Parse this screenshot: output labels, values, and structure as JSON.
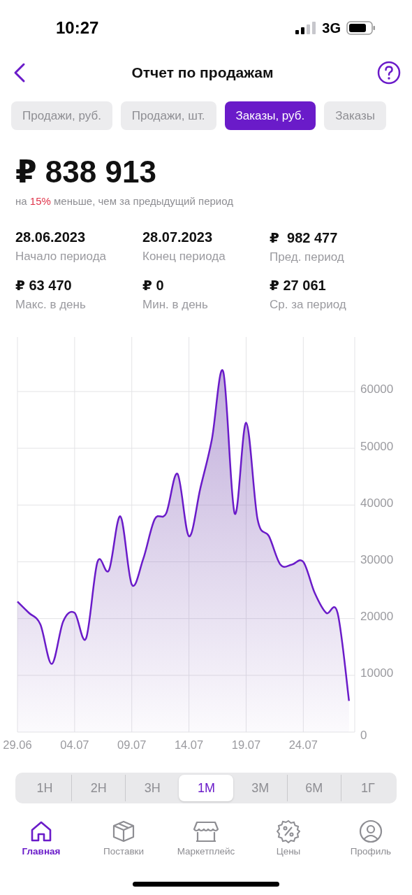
{
  "status_bar": {
    "time": "10:27",
    "network": "3G"
  },
  "header": {
    "title": "Отчет по продажам"
  },
  "tabs": [
    {
      "label": "Продажи, руб.",
      "selected": false
    },
    {
      "label": "Продажи, шт.",
      "selected": false
    },
    {
      "label": "Заказы, руб.",
      "selected": true
    },
    {
      "label": "Заказы",
      "selected": false
    }
  ],
  "total": {
    "amount": "₽ 838 913",
    "comparison": {
      "before": "на",
      "highlight": "15%",
      "after": "меньше, чем за предыдущий период"
    }
  },
  "stats": [
    {
      "value": "28.06.2023",
      "label": "Начало периода"
    },
    {
      "value": "28.07.2023",
      "label": "Конец периода"
    },
    {
      "value": "₽  982 477",
      "label": "Пред. период"
    },
    {
      "value": "₽ 63 470",
      "label": "Макс. в день"
    },
    {
      "value": "₽ 0",
      "label": "Мин. в день"
    },
    {
      "value": "₽ 27 061",
      "label": "Ср. за период"
    }
  ],
  "chart": {
    "chart_data": {
      "type": "area",
      "grid": true,
      "categories": [
        "29.06",
        null,
        null,
        null,
        null,
        "04.07",
        null,
        null,
        null,
        null,
        "09.07",
        null,
        null,
        null,
        null,
        "14.07",
        null,
        null,
        null,
        null,
        "19.07",
        null,
        null,
        null,
        null,
        "24.07",
        null,
        null,
        null,
        null
      ],
      "series": [
        {
          "color": "#6a1bc9",
          "values": [
            23000,
            21000,
            19000,
            12000,
            19500,
            21000,
            16500,
            30000,
            28500,
            38000,
            26000,
            30500,
            37500,
            38500,
            45500,
            34500,
            43000,
            51500,
            63500,
            38500,
            54500,
            37500,
            34500,
            29500,
            29500,
            30000,
            24500,
            21000,
            21000,
            5500
          ]
        }
      ],
      "ylim": [
        0,
        69600
      ],
      "yticks": [
        0,
        10000,
        20000,
        30000,
        40000,
        50000,
        60000
      ]
    }
  },
  "periods": [
    {
      "label": "1Н",
      "selected": false
    },
    {
      "label": "2Н",
      "selected": false
    },
    {
      "label": "3Н",
      "selected": false
    },
    {
      "label": "1М",
      "selected": true
    },
    {
      "label": "3М",
      "selected": false
    },
    {
      "label": "6М",
      "selected": false
    },
    {
      "label": "1Г",
      "selected": false
    }
  ],
  "bottom_nav": [
    {
      "label": "Главная",
      "selected": true
    },
    {
      "label": "Поставки",
      "selected": false
    },
    {
      "label": "Маркетплейс",
      "selected": false
    },
    {
      "label": "Цены",
      "selected": false
    },
    {
      "label": "Профиль",
      "selected": false
    }
  ]
}
